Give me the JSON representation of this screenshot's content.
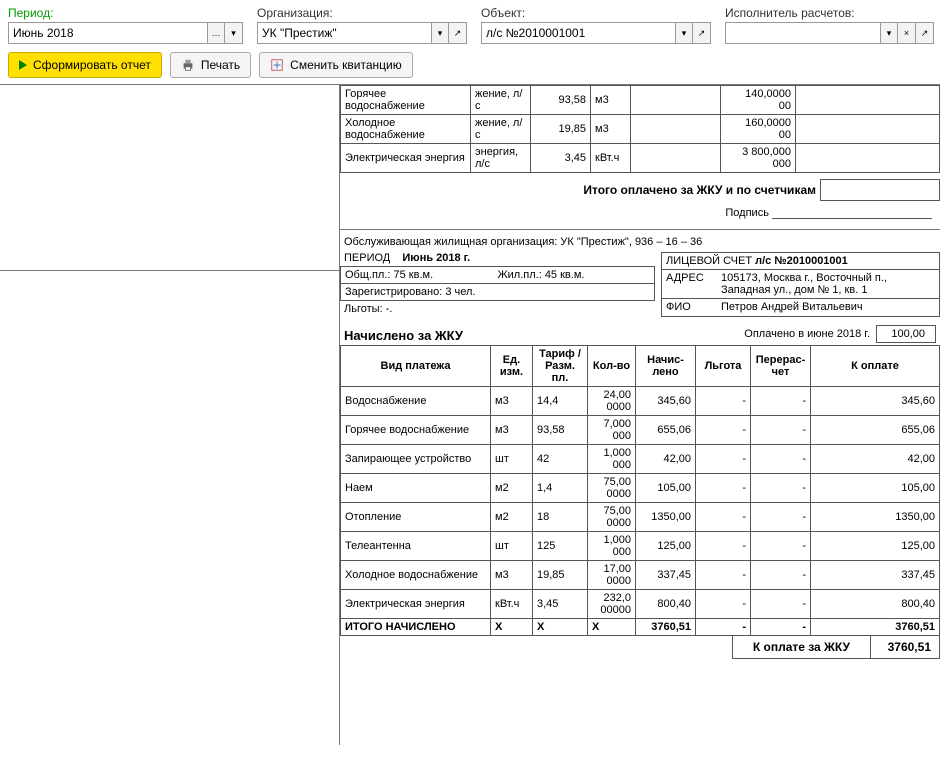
{
  "filters": {
    "period": {
      "label": "Период:",
      "value": "Июнь 2018"
    },
    "org": {
      "label": "Организация:",
      "value": "УК \"Престиж\""
    },
    "object": {
      "label": "Объект:",
      "value": "л/с №2010001001"
    },
    "executor": {
      "label": "Исполнитель расчетов:",
      "value": ""
    }
  },
  "buttons": {
    "form": "Сформировать отчет",
    "print": "Печать",
    "change": "Сменить квитанцию"
  },
  "top_rows": [
    {
      "name": "Горячее водоснабжение",
      "meter": "жение, л/с",
      "tariff": "93,58",
      "unit": "м3",
      "amount": "140,0000\n00"
    },
    {
      "name": "Холодное водоснабжение",
      "meter": "жение, л/с",
      "tariff": "19,85",
      "unit": "м3",
      "amount": "160,0000\n00"
    },
    {
      "name": "Электрическая энергия",
      "meter": "энергия, л/с",
      "tariff": "3,45",
      "unit": "кВт.ч",
      "amount": "3 800,000\n000"
    }
  ],
  "top_total_label": "Итого оплачено за ЖКУ и по счетчикам",
  "signature_label": "Подпись",
  "org_line": "Обслуживающая жилищная организация: УК \"Престиж\", 936 – 16 – 36",
  "period_line_label": "ПЕРИОД",
  "period_line_value": "Июнь 2018 г.",
  "premises": {
    "total": "Общ.пл.: 75 кв.м.",
    "living": "Жил.пл.: 45 кв.м.",
    "registered": "Зарегистрировано: 3 чел.",
    "benefits": "Льготы: -."
  },
  "account": {
    "acc_label": "ЛИЦЕВОЙ СЧЕТ",
    "acc_value": "л/с №2010001001",
    "addr_label": "АДРЕС",
    "addr_value": "105173, Москва г., Восточный п., Западная ул., дом № 1, кв. 1",
    "fio_label": "ФИО",
    "fio_value": "Петров Андрей Витальевич"
  },
  "charges_header": "Начислено за ЖКУ",
  "paid_label": "Оплачено в июне 2018 г.",
  "paid_value": "100,00",
  "columns": {
    "name": "Вид платежа",
    "unit": "Ед. изм.",
    "tariff": "Тариф / Разм. пл.",
    "qty": "Кол-во",
    "accrued": "Начис-лено",
    "benefit": "Льгота",
    "recalc": "Перерас-чет",
    "topay": "К оплате"
  },
  "charges": [
    {
      "name": "Водоснабжение",
      "unit": "м3",
      "tariff": "14,4",
      "qty": "24,00\n0000",
      "accrued": "345,60",
      "benefit": "-",
      "recalc": "-",
      "topay": "345,60"
    },
    {
      "name": "Горячее водоснабжение",
      "unit": "м3",
      "tariff": "93,58",
      "qty": "7,000\n000",
      "accrued": "655,06",
      "benefit": "-",
      "recalc": "-",
      "topay": "655,06"
    },
    {
      "name": "Запирающее устройство",
      "unit": "шт",
      "tariff": "42",
      "qty": "1,000\n000",
      "accrued": "42,00",
      "benefit": "-",
      "recalc": "-",
      "topay": "42,00"
    },
    {
      "name": "Наем",
      "unit": "м2",
      "tariff": "1,4",
      "qty": "75,00\n0000",
      "accrued": "105,00",
      "benefit": "-",
      "recalc": "-",
      "topay": "105,00"
    },
    {
      "name": "Отопление",
      "unit": "м2",
      "tariff": "18",
      "qty": "75,00\n0000",
      "accrued": "1350,00",
      "benefit": "-",
      "recalc": "-",
      "topay": "1350,00"
    },
    {
      "name": "Телеантенна",
      "unit": "шт",
      "tariff": "125",
      "qty": "1,000\n000",
      "accrued": "125,00",
      "benefit": "-",
      "recalc": "-",
      "topay": "125,00"
    },
    {
      "name": "Холодное водоснабжение",
      "unit": "м3",
      "tariff": "19,85",
      "qty": "17,00\n0000",
      "accrued": "337,45",
      "benefit": "-",
      "recalc": "-",
      "topay": "337,45"
    },
    {
      "name": "Электрическая энергия",
      "unit": "кВт.ч",
      "tariff": "3,45",
      "qty": "232,0\n00000",
      "accrued": "800,40",
      "benefit": "-",
      "recalc": "-",
      "topay": "800,40"
    }
  ],
  "totals": {
    "label": "ИТОГО НАЧИСЛЕНО",
    "unit": "Х",
    "tariff": "Х",
    "qty": "Х",
    "accrued": "3760,51",
    "benefit": "-",
    "recalc": "-",
    "topay": "3760,51"
  },
  "final": {
    "label": "К оплате за ЖКУ",
    "value": "3760,51"
  }
}
